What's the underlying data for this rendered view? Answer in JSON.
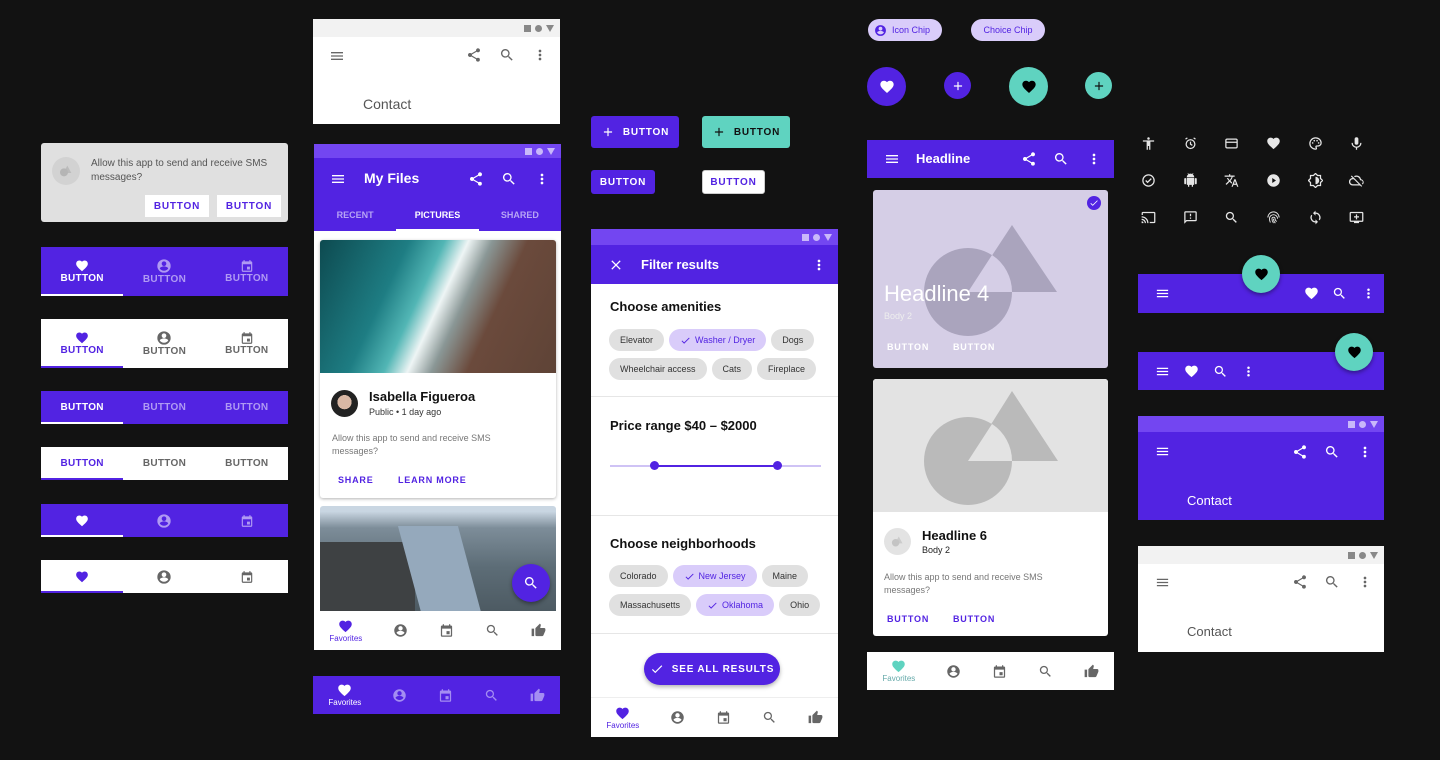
{
  "colors": {
    "primary": "#5223e2",
    "primary_light": "#7346f1",
    "secondary": "#5fd3c0",
    "chip_selected": "#d9ccfa",
    "surface": "#ffffff",
    "background": "#121212"
  },
  "banner": {
    "text": "Allow this app to send and receive SMS messages?",
    "buttons": [
      "BUTTON",
      "BUTTON"
    ]
  },
  "tabbars": {
    "label": "BUTTON",
    "icon_tabs": [
      "heart-icon",
      "account-circle-icon",
      "calendar-icon"
    ]
  },
  "contact_bar_top": {
    "title": "Contact"
  },
  "my_files": {
    "title": "My Files",
    "tabs": [
      "RECENT",
      "PICTURES",
      "SHARED"
    ],
    "selected_tab": "PICTURES",
    "card": {
      "name": "Isabella Figueroa",
      "meta": "Public • 1 day ago",
      "body": "Allow this app to send and receive SMS messages?",
      "actions": [
        "SHARE",
        "LEARN MORE"
      ]
    },
    "bottom_nav": {
      "active_label": "Favorites",
      "icons": [
        "heart-icon",
        "account-circle-icon",
        "calendar-icon",
        "search-icon",
        "thumb-up-icon"
      ]
    }
  },
  "buttons": {
    "contained_icon": "BUTTON",
    "secondary_icon": "BUTTON",
    "contained": "BUTTON",
    "outlined": "BUTTON"
  },
  "filter": {
    "title": "Filter results",
    "amenities_title": "Choose amenities",
    "amenities": [
      {
        "label": "Elevator",
        "selected": false
      },
      {
        "label": "Washer / Dryer",
        "selected": true
      },
      {
        "label": "Dogs",
        "selected": false
      },
      {
        "label": "Wheelchair access",
        "selected": false
      },
      {
        "label": "Cats",
        "selected": false
      },
      {
        "label": "Fireplace",
        "selected": false
      }
    ],
    "price_title": "Price range $40 – $2000",
    "price_range": {
      "low_fraction": 0.21,
      "high_fraction": 0.79
    },
    "neighborhoods_title": "Choose neighborhoods",
    "neighborhoods": [
      {
        "label": "Colorado",
        "selected": false
      },
      {
        "label": "New Jersey",
        "selected": true
      },
      {
        "label": "Maine",
        "selected": false
      },
      {
        "label": "Massachusetts",
        "selected": false
      },
      {
        "label": "Oklahoma",
        "selected": true
      },
      {
        "label": "Ohio",
        "selected": false
      }
    ],
    "cta": "SEE ALL RESULTS",
    "bottom_nav_label": "Favorites"
  },
  "chips": {
    "icon_chip": "Icon Chip",
    "choice_chip": "Choice Chip"
  },
  "headline_bar": {
    "title": "Headline"
  },
  "card_selected": {
    "headline": "Headline 4",
    "body": "Body 2",
    "actions": [
      "BUTTON",
      "BUTTON"
    ]
  },
  "card_plain": {
    "headline": "Headline 6",
    "body": "Body 2",
    "text": "Allow this app to send and receive SMS messages?",
    "actions": [
      "BUTTON",
      "BUTTON"
    ]
  },
  "teal_nav": {
    "label": "Favorites"
  },
  "icon_grid": [
    "accessibility-icon",
    "alarm-icon",
    "credit-card-icon",
    "heart-icon",
    "palette-icon",
    "mic-icon",
    "check-circle-icon",
    "android-icon",
    "translate-icon",
    "play-circle-icon",
    "brightness-icon",
    "cloud-off-icon",
    "cast-icon",
    "feedback-icon",
    "search-icon",
    "fingerprint-icon",
    "sync-icon",
    "add-to-queue-icon"
  ],
  "contact_bar_purple": {
    "title": "Contact"
  },
  "contact_bar_white": {
    "title": "Contact"
  },
  "bottom_bar_purple": {
    "label": "Favorites"
  }
}
